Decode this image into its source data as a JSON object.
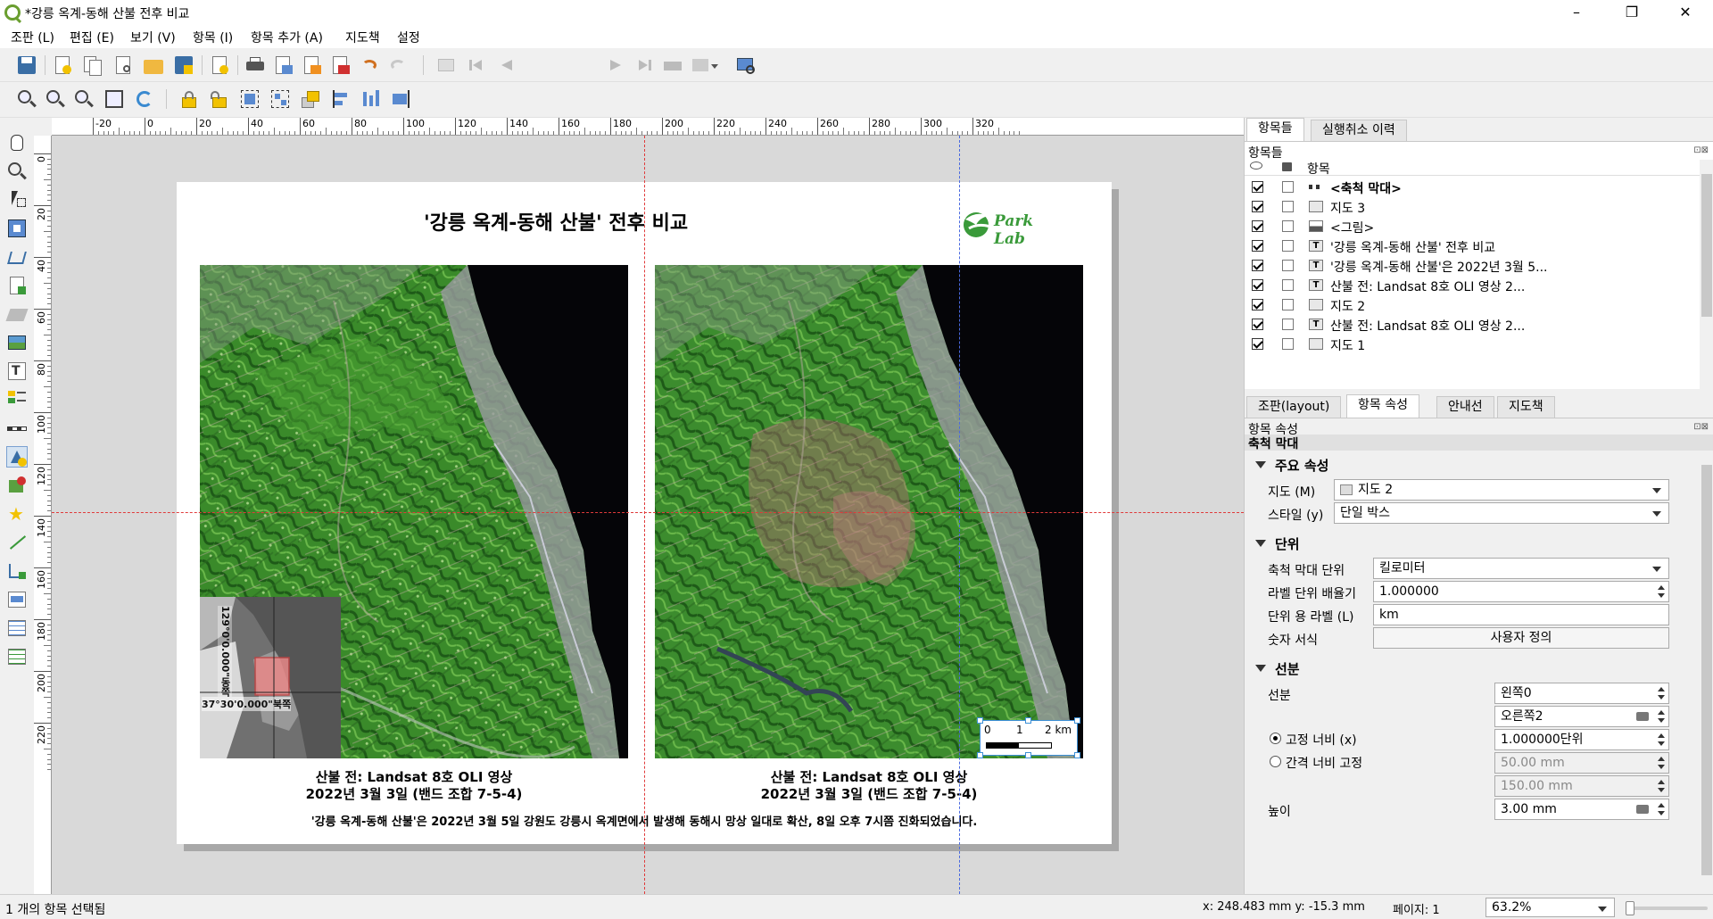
{
  "window": {
    "title": "*강릉 옥계-동해 산불 전후 비교"
  },
  "menubar": [
    {
      "label": "조판 (L)"
    },
    {
      "label": "편집 (E)"
    },
    {
      "label": "보기 (V)"
    },
    {
      "label": "항목 (I)"
    },
    {
      "label": "항목 추가 (A)"
    },
    {
      "label": "지도책"
    },
    {
      "label": "설정"
    }
  ],
  "toolbar": {
    "page_value": "1"
  },
  "rulers": {
    "h_labels": [
      "-20",
      "0",
      "20",
      "40",
      "60",
      "80",
      "100",
      "120",
      "140",
      "160",
      "180",
      "200",
      "220",
      "240",
      "260",
      "280",
      "300",
      "320"
    ],
    "v_labels": [
      "0",
      "20",
      "40",
      "60",
      "80",
      "100",
      "120",
      "140",
      "160",
      "180",
      "200",
      "220"
    ]
  },
  "layout": {
    "title": "'강릉 옥계-동해 산불' 전후 비교",
    "logo_text": "Park Lab",
    "inset_label_lon": "129°0'0.000\"동쪽",
    "inset_label_lat": "37°30'0.000\"북쪽",
    "map1_caption_line1": "산불 전: Landsat 8호 OLI 영상",
    "map1_caption_line2": "2022년 3월 3일 (밴드 조합 7-5-4)",
    "map2_caption_line1": "산불 전: Landsat 8호 OLI 영상",
    "map2_caption_line2": "2022년 3월 3일 (밴드 조합 7-5-4)",
    "footnote": "'강릉 옥계-동해 산불'은 2022년 3월 5일 강원도 강릉시 옥계면에서 발생해 동해시 망상 일대로 확산, 8일 오후 7시쯤 진화되었습니다.",
    "scalebar_labels": [
      "0",
      "1",
      "2 km"
    ]
  },
  "right_panel": {
    "top_tabs": [
      "항목들",
      "실행취소 이력"
    ],
    "items_header": "항목들",
    "col_item": "항목",
    "items": [
      {
        "label": "<축척 막대>",
        "bold": true,
        "icon": "scalebar-icon"
      },
      {
        "label": "지도 3",
        "icon": "map-icon"
      },
      {
        "label": "<그림>",
        "icon": "picture-icon"
      },
      {
        "label": "'강릉 옥계-동해 산불' 전후 비교",
        "icon": "text-icon"
      },
      {
        "label": "'강릉 옥계-동해 산불'은 2022년 3월 5...",
        "icon": "text-icon"
      },
      {
        "label": "산불 전: Landsat 8호 OLI 영상 2...",
        "icon": "text-icon"
      },
      {
        "label": "지도 2",
        "icon": "map-icon"
      },
      {
        "label": "산불 전: Landsat 8호 OLI 영상 2...",
        "icon": "text-icon"
      },
      {
        "label": "지도 1",
        "icon": "map-icon"
      }
    ],
    "bottom_tabs": [
      "조판(layout)",
      "항목 속성",
      "안내선",
      "지도책"
    ],
    "props_header": "항목 속성",
    "props_subheader": "축척 막대",
    "sec_main": "주요 속성",
    "map_label": "지도 (M)",
    "map_value": "지도 2",
    "style_label": "스타일 (y)",
    "style_value": "단일 박스",
    "sec_units": "단위",
    "unit_label": "축척 막대 단위",
    "unit_value": "킬로미터",
    "multiplier_label": "라벨 단위 배율기",
    "multiplier_value": "1.000000",
    "unit_text_label": "단위 용 라벨 (L)",
    "unit_text_value": "km",
    "num_format_label": "숫자 서식",
    "num_format_button": "사용자 정의",
    "sec_segments": "선분",
    "segments_label": "선분",
    "left_value": "왼쪽0",
    "right_value": "오른쪽2",
    "fixed_width_label": "고정 너비 (x)",
    "fixed_width_value": "1.000000단위",
    "fit_width_label": "간격 너비 고정",
    "fit_min_value": "50.00 mm",
    "fit_max_value": "150.00 mm",
    "height_label": "높이",
    "height_value": "3.00 mm"
  },
  "statusbar": {
    "selection": "1 개의 항목 선택됨",
    "coords": "x: 248.483 mm  y: -15.3 mm",
    "page": "페이지: 1",
    "zoom": "63.2%"
  },
  "colors": {
    "accent": "#3c8fd6",
    "guide_red": "#e03a3a",
    "guide_blue": "#4a6adf",
    "logo_green": "#3a9a3a"
  }
}
